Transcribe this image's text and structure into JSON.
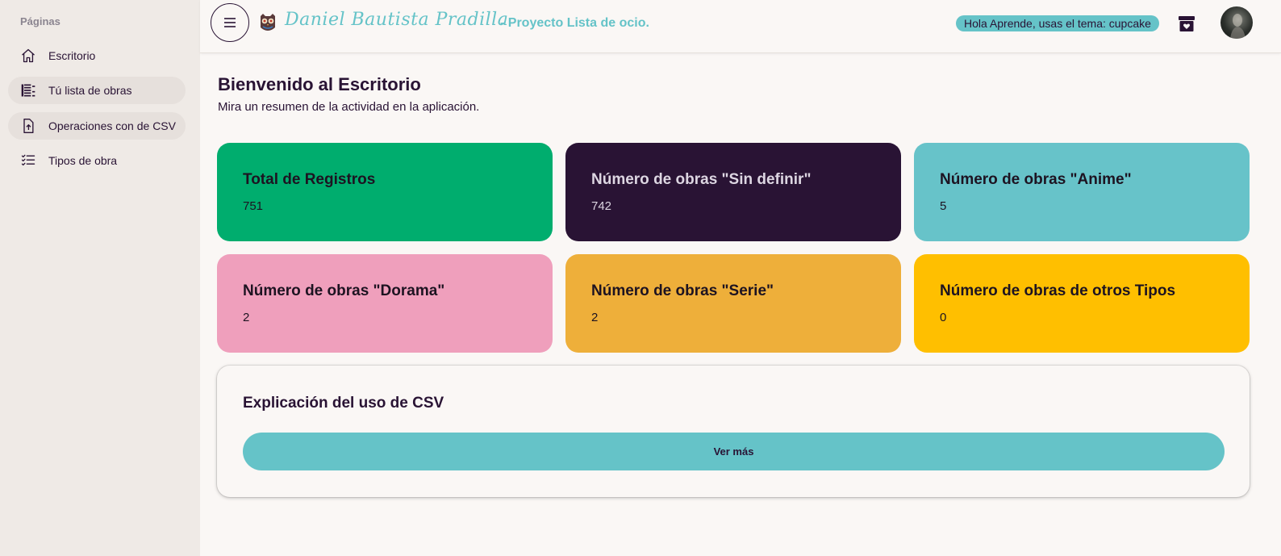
{
  "sidebar": {
    "title": "Páginas",
    "items": [
      {
        "label": "Escritorio",
        "icon": "home-icon"
      },
      {
        "label": "Tú lista de obras",
        "icon": "list-icon"
      },
      {
        "label": "Operaciones con de CSV",
        "icon": "file-upload-icon"
      },
      {
        "label": "Tipos de obra",
        "icon": "checklist-icon"
      }
    ]
  },
  "header": {
    "brand_name": "Daniel Bautista Pradilla",
    "brand_subtitle": "- Proyecto Lista de ocio.",
    "theme_badge": "Hola Aprende, usas el tema: cupcake"
  },
  "main": {
    "title": "Bienvenido al Escritorio",
    "subtitle": "Mira un resumen de la actividad en la aplicación.",
    "stats": [
      {
        "title": "Total de Registros",
        "value": "751",
        "color": "#00ad6e"
      },
      {
        "title": "Número de obras \"Sin definir\"",
        "value": "742",
        "color": "#291334"
      },
      {
        "title": "Número de obras \"Anime\"",
        "value": "5",
        "color": "#67c3c9"
      },
      {
        "title": "Número de obras \"Dorama\"",
        "value": "2",
        "color": "#ef9fbc"
      },
      {
        "title": "Número de obras \"Serie\"",
        "value": "2",
        "color": "#eeaf3a"
      },
      {
        "title": "Número de obras de otros Tipos",
        "value": "0",
        "color": "#ffbf00"
      }
    ],
    "csv_card": {
      "title": "Explicación del uso de CSV",
      "button_label": "Ver más"
    }
  },
  "colors": {
    "primary": "#65c3c8",
    "base": "#faf7f5",
    "text": "#291334"
  }
}
